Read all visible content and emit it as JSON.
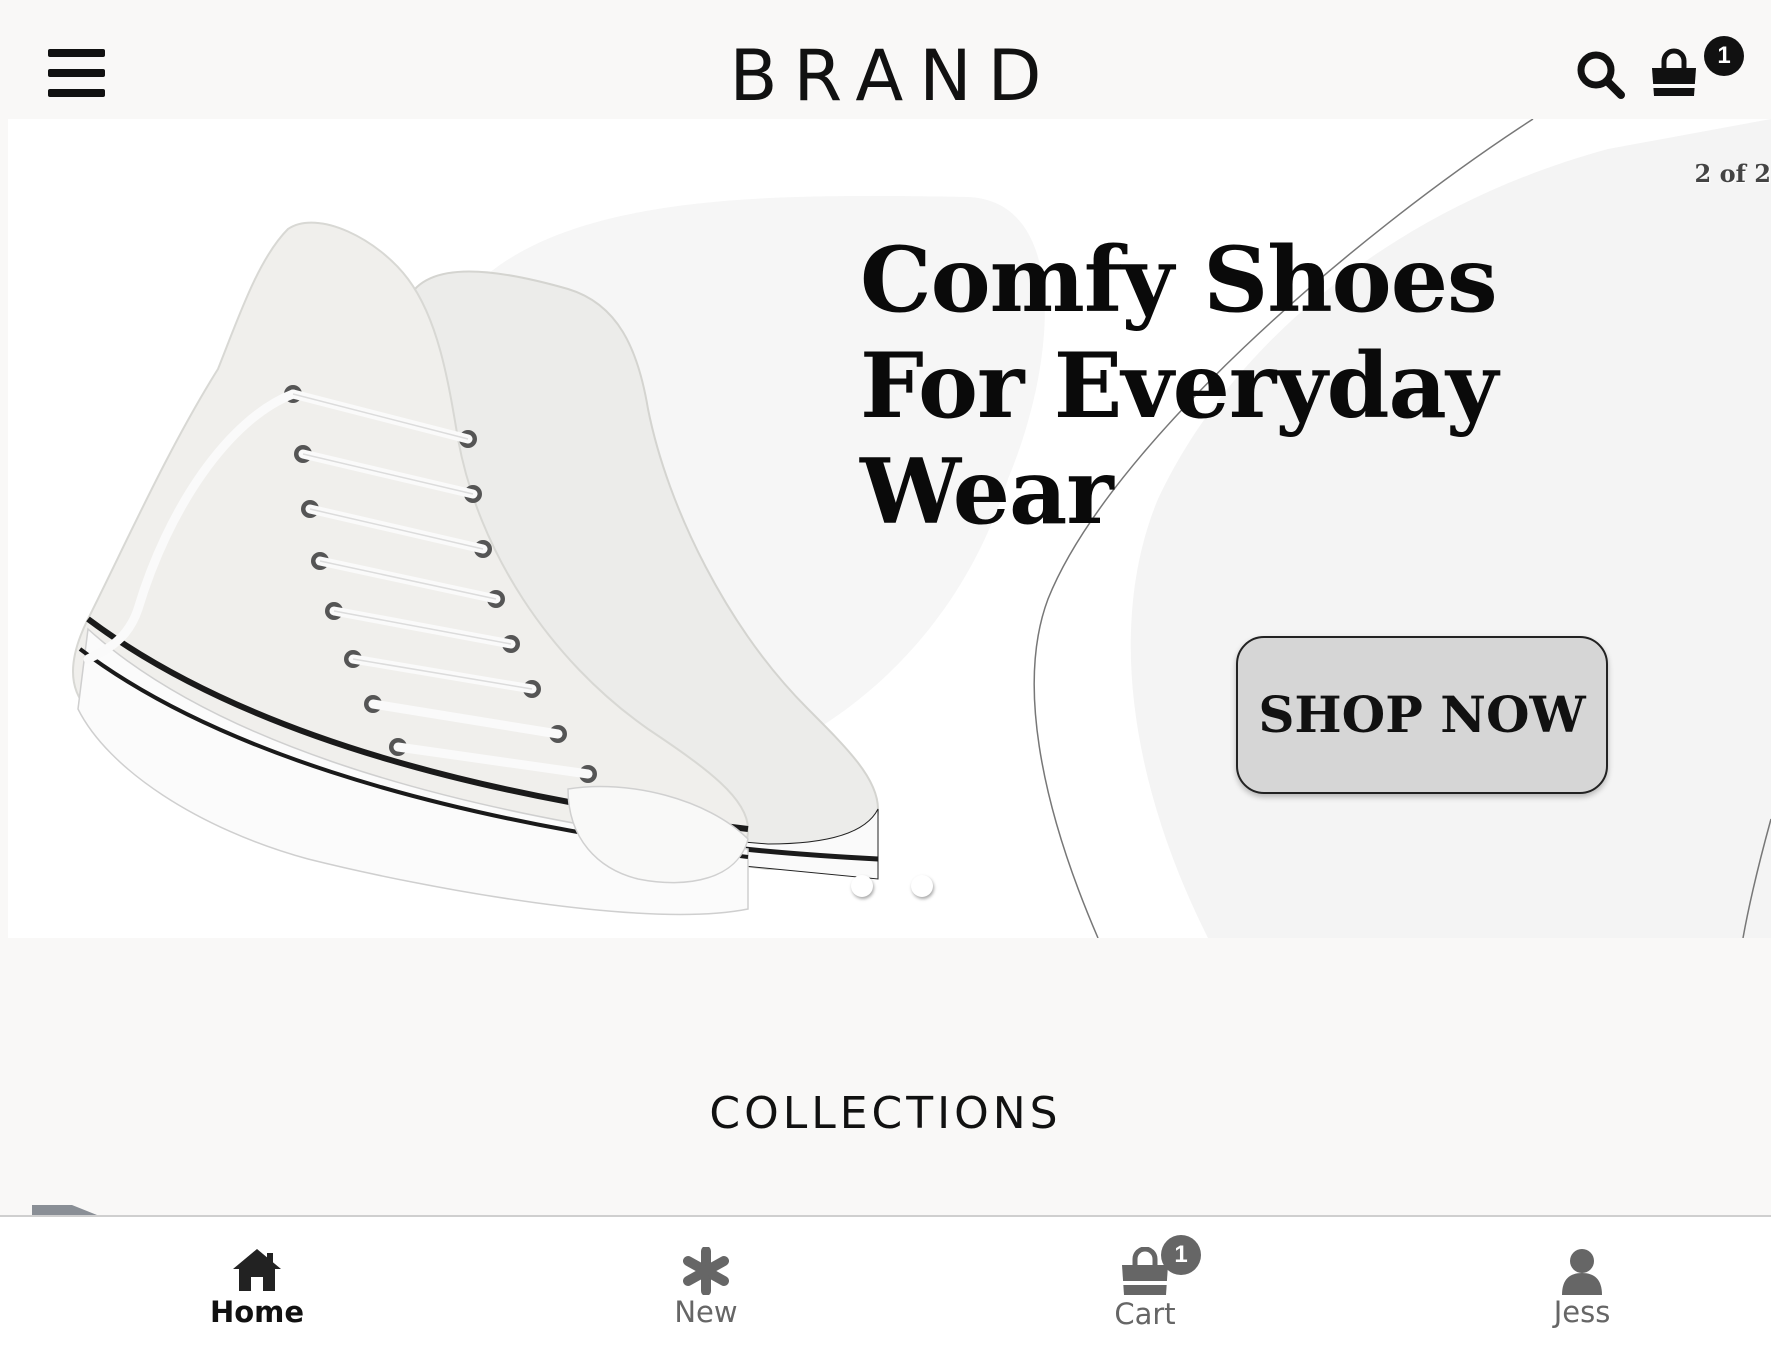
{
  "header": {
    "brand": "BRAND",
    "cart_count": "1"
  },
  "hero": {
    "slide_counter": "2 of 2",
    "headline_lines": [
      "Comfy Shoes",
      "For Everyday",
      "Wear"
    ],
    "cta_label": "SHOP NOW",
    "slide_count": 2,
    "active_slide": 2
  },
  "collections": {
    "title": "COLLECTIONS"
  },
  "bottom_nav": {
    "items": [
      {
        "label": "Home",
        "icon": "home-icon",
        "active": true
      },
      {
        "label": "New",
        "icon": "asterisk-icon",
        "active": false
      },
      {
        "label": "Cart",
        "icon": "shopping-bag-icon",
        "active": false,
        "badge": "1"
      },
      {
        "label": "Jess",
        "icon": "user-icon",
        "active": false
      }
    ]
  },
  "colors": {
    "page_background": "#f9f8f7",
    "hero_background": "#ffffff",
    "button_background": "#d6d6d6",
    "text": "#111111",
    "inactive_nav": "#666666"
  }
}
